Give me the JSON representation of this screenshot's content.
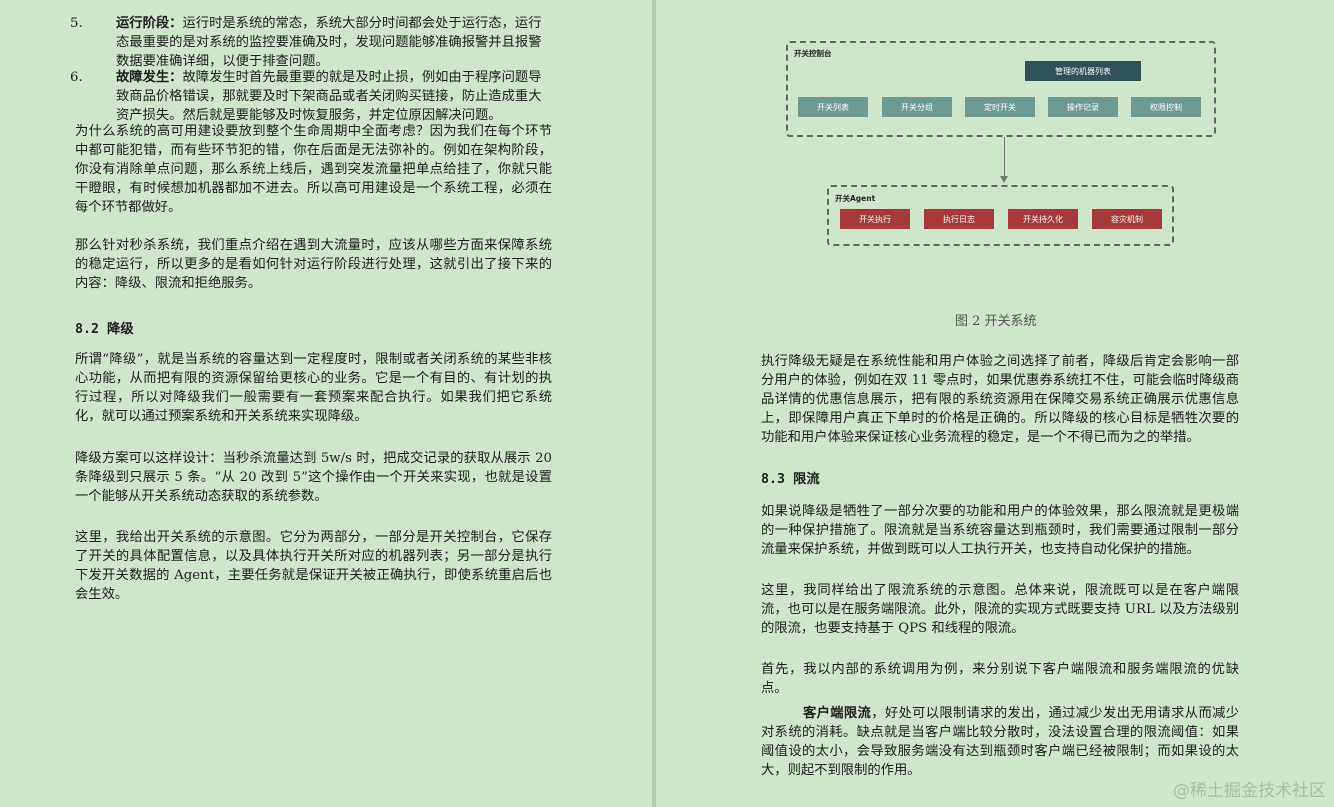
{
  "left": {
    "list": [
      {
        "num": "5.",
        "title": "运行阶段：",
        "text": "运行时是系统的常态，系统大部分时间都会处于运行态，运行态最重要的是对系统的监控要准确及时，发现问题能够准确报警并且报警数据要准确详细，以便于排查问题。"
      },
      {
        "num": "6.",
        "title": "故障发生：",
        "text": "故障发生时首先最重要的就是及时止损，例如由于程序问题导致商品价格错误，那就要及时下架商品或者关闭购买链接，防止造成重大资产损失。然后就是要能够及时恢复服务，并定位原因解决问题。"
      }
    ],
    "p1": "为什么系统的高可用建设要放到整个生命周期中全面考虑？因为我们在每个环节中都可能犯错，而有些环节犯的错，你在后面是无法弥补的。例如在架构阶段，你没有消除单点问题，那么系统上线后，遇到突发流量把单点给挂了，你就只能干瞪眼，有时候想加机器都加不进去。所以高可用建设是一个系统工程，必须在每个环节都做好。",
    "p2": "那么针对秒杀系统，我们重点介绍在遇到大流量时，应该从哪些方面来保障系统的稳定运行，所以更多的是看如何针对运行阶段进行处理，这就引出了接下来的内容：降级、限流和拒绝服务。",
    "h82_num": "8.2",
    "h82_title": "降级",
    "p3": "所谓“降级”，就是当系统的容量达到一定程度时，限制或者关闭系统的某些非核心功能，从而把有限的资源保留给更核心的业务。它是一个有目的、有计划的执行过程，所以对降级我们一般需要有一套预案来配合执行。如果我们把它系统化，就可以通过预案系统和开关系统来实现降级。",
    "p4": "降级方案可以这样设计：当秒杀流量达到 5w/s 时，把成交记录的获取从展示 20 条降级到只展示 5 条。“从 20 改到 5”这个操作由一个开关来实现，也就是设置一个能够从开关系统动态获取的系统参数。",
    "p5": "这里，我给出开关系统的示意图。它分为两部分，一部分是开关控制台，它保存了开关的具体配置信息，以及具体执行开关所对应的机器列表；另一部分是执行下发开关数据的 Agent，主要任务就是保证开关被正确执行，即使系统重启后也会生效。"
  },
  "diagram": {
    "console_label": "开关控制台",
    "machine_list": "管理的机器列表",
    "console_items": [
      "开关列表",
      "开关分组",
      "定时开关",
      "操作记录",
      "权限控制"
    ],
    "agent_label": "开关Agent",
    "agent_items": [
      "开关执行",
      "执行日志",
      "开关持久化",
      "容灾机制"
    ],
    "caption": "图 2 开关系统"
  },
  "right": {
    "p1": "执行降级无疑是在系统性能和用户体验之间选择了前者，降级后肯定会影响一部分用户的体验，例如在双 11 零点时，如果优惠券系统扛不住，可能会临时降级商品详情的优惠信息展示，把有限的系统资源用在保障交易系统正确展示优惠信息上，即保障用户真正下单时的价格是正确的。所以降级的核心目标是牺牲次要的功能和用户体验来保证核心业务流程的稳定，是一个不得已而为之的举措。",
    "h83_num": "8.3",
    "h83_title": "限流",
    "p2": "如果说降级是牺牲了一部分次要的功能和用户的体验效果，那么限流就是更极端的一种保护措施了。限流就是当系统容量达到瓶颈时，我们需要通过限制一部分流量来保护系统，并做到既可以人工执行开关，也支持自动化保护的措施。",
    "p3": "这里，我同样给出了限流系统的示意图。总体来说，限流既可以是在客户端限流，也可以是在服务端限流。此外，限流的实现方式既要支持 URL 以及方法级别的限流，也要支持基于 QPS 和线程的限流。",
    "p4": "首先，我以内部的系统调用为例，来分别说下客户端限流和服务端限流的优缺点。",
    "p5_bold": "客户端限流",
    "p5": "，好处可以限制请求的发出，通过减少发出无用请求从而减少对系统的消耗。缺点就是当客户端比较分散时，没法设置合理的限流阈值：如果阈值设的太小，会导致服务端没有达到瓶颈时客户端已经被限制；而如果设的太大，则起不到限制的作用。"
  },
  "watermark": "@稀土掘金技术社区"
}
